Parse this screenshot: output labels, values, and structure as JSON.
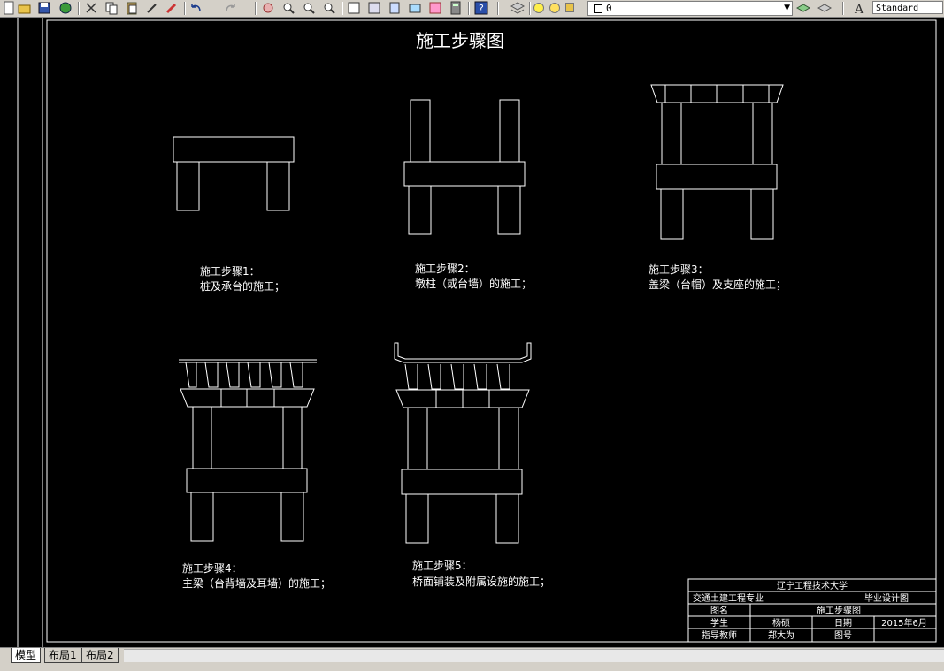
{
  "toolbar": {
    "icons": [
      "new-icon",
      "open-icon",
      "save-icon",
      "plot-icon",
      "preview-icon",
      "publish-icon",
      "cut-icon",
      "copy-icon",
      "paste-icon",
      "matchprop-icon",
      "brush-icon",
      "undo-icon",
      "redo-icon",
      "pan-icon",
      "zoom-realtime-icon",
      "zoom-window-icon",
      "zoom-previous-icon",
      "properties-icon",
      "designcenter-icon",
      "toolpalette-icon",
      "sheetset-icon",
      "markup-icon",
      "calculator-icon",
      "help-icon",
      "layer-manager-icon",
      "layer-state-icon",
      "layer-previous-icon",
      "textstyle-icon"
    ],
    "layer_value": "0",
    "text_style": "Standard"
  },
  "drawing": {
    "title": "施工步骤图",
    "steps": [
      {
        "label": "施工步骤1：",
        "desc": "桩及承台的施工；"
      },
      {
        "label": "施工步骤2：",
        "desc": "墩柱（或台墙）的施工；"
      },
      {
        "label": "施工步骤3：",
        "desc": "盖梁（台帽）及支座的施工；"
      },
      {
        "label": "施工步骤4：",
        "desc": "主梁（台背墙及耳墙）的施工；"
      },
      {
        "label": "施工步骤5：",
        "desc": "桥面铺装及附属设施的施工；"
      }
    ]
  },
  "title_block": {
    "university": "辽宁工程技术大学",
    "major": "交通土建工程专业",
    "design": "毕业设计图",
    "drawing_name_label": "图名",
    "drawing_name": "施工步骤图",
    "student_label": "学生",
    "student": "杨硕",
    "date_label": "日期",
    "date": "2015年6月",
    "teacher_label": "指导教师",
    "teacher": "郑大为",
    "drawing_no_label": "图号",
    "drawing_no": ""
  },
  "tabs": [
    "模型",
    "布局1",
    "布局2"
  ],
  "colors": {
    "canvas": "#000000",
    "lines": "#ffffff",
    "ui": "#d4d0c8"
  }
}
